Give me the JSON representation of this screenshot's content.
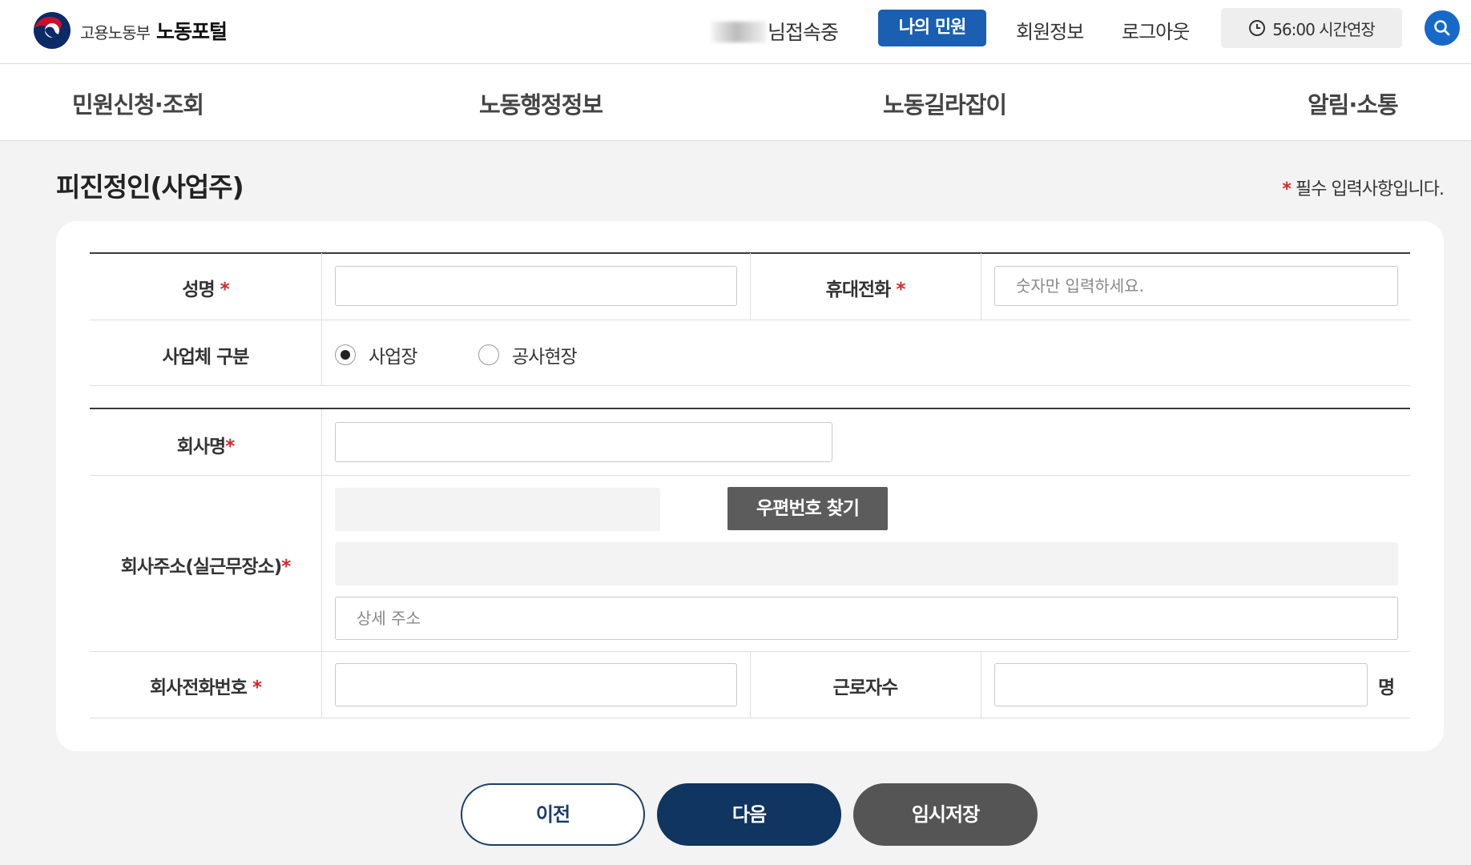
{
  "header": {
    "ministry_name": "고용노동부",
    "portal_name": "노동포털",
    "user_status": "님접속중",
    "my_petition": "나의 민원",
    "member_info": "회원정보",
    "logout": "로그아웃",
    "time_extend": "56:00 시간연장",
    "search_icon": "search-icon"
  },
  "nav": {
    "items": [
      "민원신청·조회",
      "노동행정정보",
      "노동길라잡이",
      "알림·소통"
    ]
  },
  "page": {
    "title": "피진정인(사업주)",
    "required_note": "필수 입력사항입니다.",
    "required_mark": "*"
  },
  "form": {
    "name_label": "성명",
    "mobile_label": "휴대전화",
    "mobile_placeholder": "숫자만 입력하세요.",
    "biz_type_label": "사업체 구분",
    "biz_type_options": [
      "사업장",
      "공사현장"
    ],
    "biz_type_selected": "사업장",
    "company_name_label": "회사명",
    "company_address_label": "회사주소(실근무장소)",
    "zip_search_button": "우편번호 찾기",
    "detail_address_placeholder": "상세 주소",
    "company_phone_label": "회사전화번호",
    "workers_label": "근로자수",
    "workers_unit": "명"
  },
  "actions": {
    "prev": "이전",
    "next": "다음",
    "temp_save": "임시저장"
  },
  "colors": {
    "primary_blue": "#1a5fb1",
    "navy": "#0f3560",
    "required_red": "#d9262b",
    "gray_button": "#555555"
  }
}
